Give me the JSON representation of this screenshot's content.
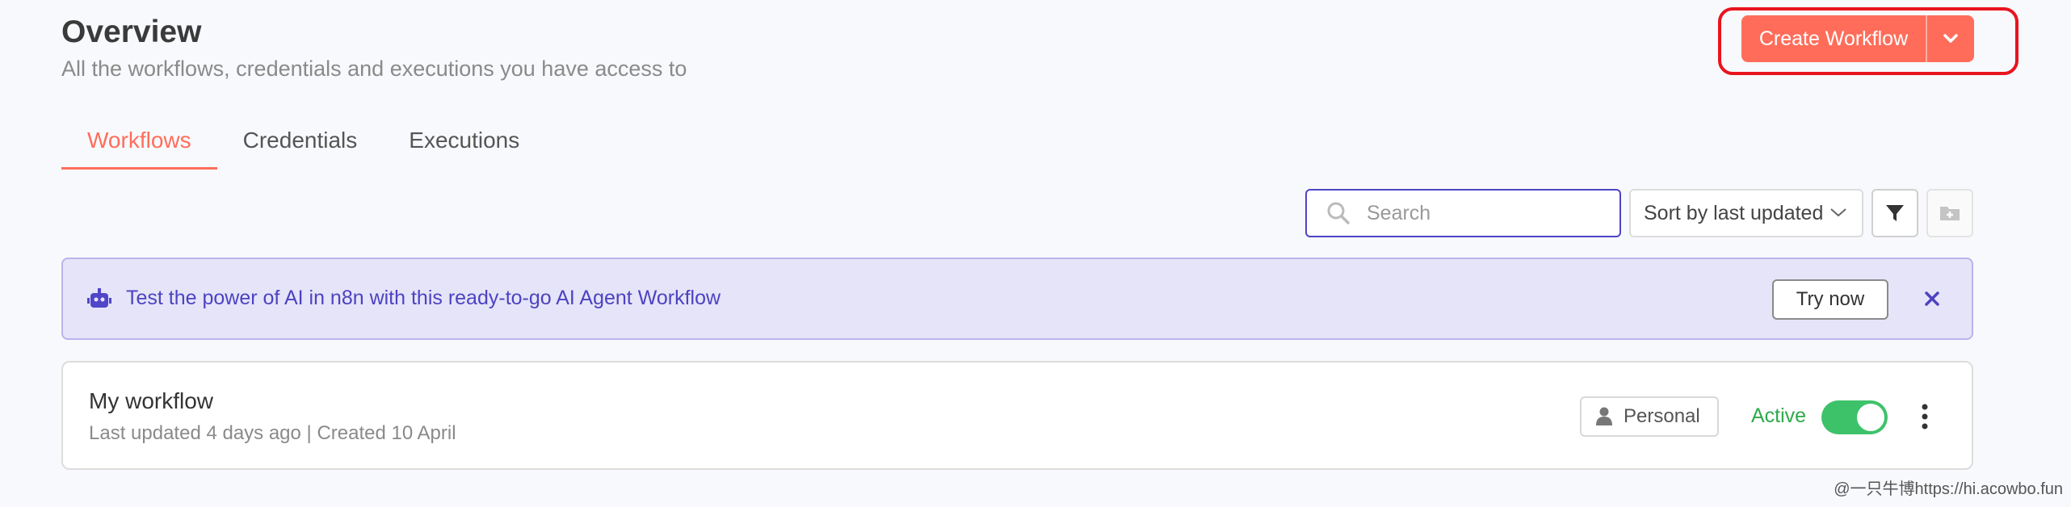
{
  "header": {
    "title": "Overview",
    "subtitle": "All the workflows, credentials and executions you have access to",
    "create_label": "Create Workflow"
  },
  "tabs": [
    {
      "label": "Workflows",
      "active": true
    },
    {
      "label": "Credentials",
      "active": false
    },
    {
      "label": "Executions",
      "active": false
    }
  ],
  "toolbar": {
    "search_placeholder": "Search",
    "search_value": "",
    "sort_label": "Sort by last updated"
  },
  "banner": {
    "message": "Test the power of AI in n8n with this ready-to-go AI Agent Workflow",
    "action_label": "Try now"
  },
  "workflows": [
    {
      "name": "My workflow",
      "meta": "Last updated 4 days ago | Created 10 April",
      "owner_badge": "Personal",
      "status_label": "Active",
      "active": true
    }
  ],
  "watermark": "@一只牛博https://hi.acowbo.fun",
  "colors": {
    "accent": "#ff6d5a",
    "banner_bg": "#e6e4f8",
    "banner_text": "#4c43c2",
    "active_green": "#3dc26a",
    "highlight_red": "#e8141e"
  },
  "icons": [
    "chevron-down-icon",
    "search-icon",
    "filter-icon",
    "folder-plus-icon",
    "robot-icon",
    "close-icon",
    "user-icon",
    "kebab-menu-icon"
  ]
}
